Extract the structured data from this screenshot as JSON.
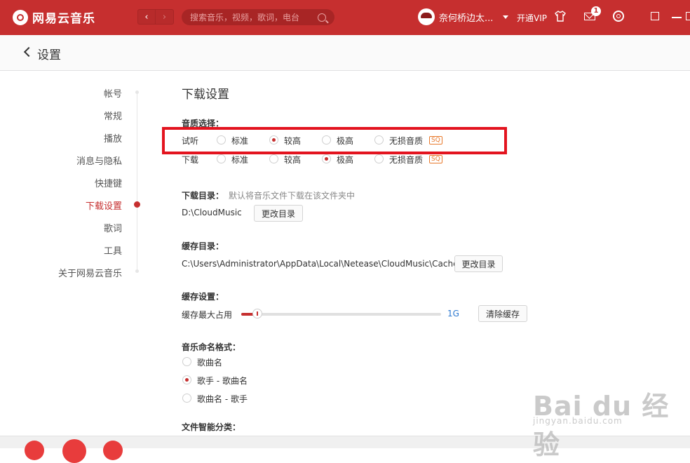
{
  "app": {
    "name": "网易云音乐"
  },
  "search": {
    "placeholder": "搜索音乐，视频，歌词，电台"
  },
  "user": {
    "name": "奈何桥边太..."
  },
  "topbar": {
    "vip": "开通VIP",
    "mail_badge": "1",
    "back_glyph": "‹",
    "fwd_glyph": "›"
  },
  "page": {
    "title": "设置"
  },
  "sidebar": {
    "items": [
      "帐号",
      "常规",
      "播放",
      "消息与隐私",
      "快捷键",
      "下载设置",
      "歌词",
      "工具",
      "关于网易云音乐"
    ],
    "active": "下载设置"
  },
  "download": {
    "title": "下载设置",
    "quality_label": "音质选择：",
    "preview_label": "试听",
    "download_label": "下载",
    "options": [
      "标准",
      "较高",
      "极高",
      "无损音质"
    ],
    "sq_badge": "SQ",
    "preview_selected": "较高",
    "download_selected": "极高",
    "dir_label": "下载目录：",
    "dir_hint": "默认将音乐文件下载在该文件夹中",
    "dir_path": "D:\\CloudMusic",
    "change_dir": "更改目录",
    "cache_dir_label": "缓存目录：",
    "cache_path": "C:\\Users\\Administrator\\AppData\\Local\\Netease\\CloudMusic\\Cache",
    "cache_set_label": "缓存设置：",
    "cache_max_label": "缓存最大占用",
    "cache_value": "1G",
    "cache_fraction": 0.08,
    "clear_cache": "清除缓存",
    "naming_label": "音乐命名格式：",
    "naming_options": [
      "歌曲名",
      "歌手 - 歌曲名",
      "歌曲名 - 歌手"
    ],
    "naming_selected": "歌手 - 歌曲名",
    "smart_label": "文件智能分类："
  },
  "watermark": {
    "big": "Bai du 经验",
    "small": "jingyan.baidu.com"
  },
  "colors": {
    "brand": "#c62f2f",
    "highlight": "#e3141f",
    "accent": "#2c79d1"
  }
}
